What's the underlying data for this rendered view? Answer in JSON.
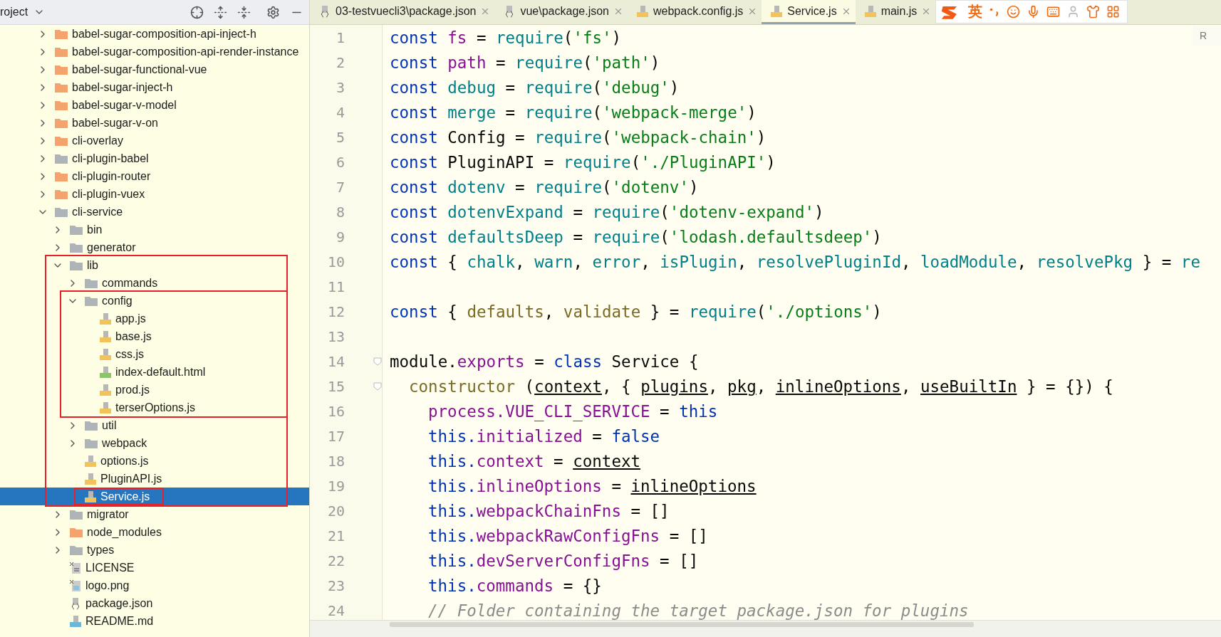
{
  "project_panel": {
    "title": "roject"
  },
  "tree": [
    {
      "name": "babel-sugar-composition-api-inject-h",
      "kind": "excluded-folder",
      "expanded": false,
      "selected": false,
      "outlined": false
    },
    {
      "name": "babel-sugar-composition-api-render-instance",
      "kind": "excluded-folder",
      "expanded": false,
      "selected": false,
      "outlined": false
    },
    {
      "name": "babel-sugar-functional-vue",
      "kind": "excluded-folder",
      "expanded": false,
      "selected": false,
      "outlined": false
    },
    {
      "name": "babel-sugar-inject-h",
      "kind": "excluded-folder",
      "expanded": false,
      "selected": false,
      "outlined": false
    },
    {
      "name": "babel-sugar-v-model",
      "kind": "excluded-folder",
      "expanded": false,
      "selected": false,
      "outlined": false
    },
    {
      "name": "babel-sugar-v-on",
      "kind": "excluded-folder",
      "expanded": false,
      "selected": false,
      "outlined": false
    },
    {
      "name": "cli-overlay",
      "kind": "excluded-folder",
      "expanded": false,
      "selected": false,
      "outlined": false
    },
    {
      "name": "cli-plugin-babel",
      "kind": "folder",
      "expanded": false,
      "selected": false,
      "outlined": false
    },
    {
      "name": "cli-plugin-router",
      "kind": "excluded-folder",
      "expanded": false,
      "selected": false,
      "outlined": false
    },
    {
      "name": "cli-plugin-vuex",
      "kind": "excluded-folder",
      "expanded": false,
      "selected": false,
      "outlined": false
    },
    {
      "name": "cli-service",
      "kind": "folder",
      "expanded": true,
      "selected": false,
      "outlined": false,
      "children": [
        {
          "name": "bin",
          "kind": "folder",
          "expanded": false,
          "selected": false,
          "outlined": false
        },
        {
          "name": "generator",
          "kind": "folder",
          "expanded": false,
          "selected": false,
          "outlined": false
        },
        {
          "name": "lib",
          "kind": "folder",
          "expanded": true,
          "selected": false,
          "outlined": true,
          "children": [
            {
              "name": "commands",
              "kind": "folder",
              "expanded": false,
              "selected": false,
              "outlined": false
            },
            {
              "name": "config",
              "kind": "folder",
              "expanded": true,
              "selected": false,
              "outlined": true,
              "children": [
                {
                  "name": "app.js",
                  "kind": "js",
                  "selected": false,
                  "outlined": false
                },
                {
                  "name": "base.js",
                  "kind": "js",
                  "selected": false,
                  "outlined": false
                },
                {
                  "name": "css.js",
                  "kind": "js",
                  "selected": false,
                  "outlined": false
                },
                {
                  "name": "index-default.html",
                  "kind": "html",
                  "selected": false,
                  "outlined": false
                },
                {
                  "name": "prod.js",
                  "kind": "js",
                  "selected": false,
                  "outlined": false
                },
                {
                  "name": "terserOptions.js",
                  "kind": "js",
                  "selected": false,
                  "outlined": false
                }
              ]
            },
            {
              "name": "util",
              "kind": "folder",
              "expanded": false,
              "selected": false,
              "outlined": false
            },
            {
              "name": "webpack",
              "kind": "folder",
              "expanded": false,
              "selected": false,
              "outlined": false
            },
            {
              "name": "options.js",
              "kind": "js",
              "selected": false,
              "outlined": false
            },
            {
              "name": "PluginAPI.js",
              "kind": "js",
              "selected": false,
              "outlined": false
            },
            {
              "name": "Service.js",
              "kind": "js",
              "selected": true,
              "outlined": true
            }
          ]
        },
        {
          "name": "migrator",
          "kind": "folder",
          "expanded": false,
          "selected": false,
          "outlined": false
        },
        {
          "name": "node_modules",
          "kind": "excluded-folder",
          "expanded": false,
          "selected": false,
          "outlined": false
        },
        {
          "name": "types",
          "kind": "folder",
          "expanded": false,
          "selected": false,
          "outlined": false
        },
        {
          "name": "LICENSE",
          "kind": "text",
          "selected": false,
          "outlined": false
        },
        {
          "name": "logo.png",
          "kind": "image",
          "selected": false,
          "outlined": false
        },
        {
          "name": "package.json",
          "kind": "json",
          "selected": false,
          "outlined": false
        },
        {
          "name": "README.md",
          "kind": "md",
          "selected": false,
          "outlined": false
        }
      ]
    }
  ],
  "tabs": [
    {
      "label": "03-testvuecli3\\package.json",
      "kind": "json",
      "selected": false
    },
    {
      "label": "vue\\package.json",
      "kind": "json",
      "selected": false
    },
    {
      "label": "webpack.config.js",
      "kind": "js",
      "selected": false
    },
    {
      "label": "Service.js",
      "kind": "js",
      "selected": true
    },
    {
      "label": "main.js",
      "kind": "js",
      "selected": false
    }
  ],
  "ime_toolbar": {
    "language": "英"
  },
  "editor_corner": "R",
  "code": [
    {
      "number": "1",
      "tokens": [
        {
          "kind": "kw",
          "text": "const "
        },
        {
          "kind": "def",
          "text": "fs"
        },
        {
          "kind": "plain",
          "text": " = "
        },
        {
          "kind": "fn",
          "text": "require"
        },
        {
          "kind": "plain",
          "text": "("
        },
        {
          "kind": "str",
          "text": "'fs'"
        },
        {
          "kind": "plain",
          "text": ")"
        }
      ]
    },
    {
      "number": "2",
      "tokens": [
        {
          "kind": "kw",
          "text": "const "
        },
        {
          "kind": "def",
          "text": "path"
        },
        {
          "kind": "plain",
          "text": " = "
        },
        {
          "kind": "fn",
          "text": "require"
        },
        {
          "kind": "plain",
          "text": "("
        },
        {
          "kind": "str",
          "text": "'path'"
        },
        {
          "kind": "plain",
          "text": ")"
        }
      ]
    },
    {
      "number": "3",
      "tokens": [
        {
          "kind": "kw",
          "text": "const "
        },
        {
          "kind": "fn",
          "text": "debug"
        },
        {
          "kind": "plain",
          "text": " = "
        },
        {
          "kind": "fn",
          "text": "require"
        },
        {
          "kind": "plain",
          "text": "("
        },
        {
          "kind": "str",
          "text": "'debug'"
        },
        {
          "kind": "plain",
          "text": ")"
        }
      ]
    },
    {
      "number": "4",
      "tokens": [
        {
          "kind": "kw",
          "text": "const "
        },
        {
          "kind": "fn",
          "text": "merge"
        },
        {
          "kind": "plain",
          "text": " = "
        },
        {
          "kind": "fn",
          "text": "require"
        },
        {
          "kind": "plain",
          "text": "("
        },
        {
          "kind": "str",
          "text": "'webpack-merge'"
        },
        {
          "kind": "plain",
          "text": ")"
        }
      ]
    },
    {
      "number": "5",
      "tokens": [
        {
          "kind": "kw",
          "text": "const "
        },
        {
          "kind": "plain",
          "text": "Config = "
        },
        {
          "kind": "fn",
          "text": "require"
        },
        {
          "kind": "plain",
          "text": "("
        },
        {
          "kind": "str",
          "text": "'webpack-chain'"
        },
        {
          "kind": "plain",
          "text": ")"
        }
      ]
    },
    {
      "number": "6",
      "tokens": [
        {
          "kind": "kw",
          "text": "const "
        },
        {
          "kind": "plain",
          "text": "PluginAPI = "
        },
        {
          "kind": "fn",
          "text": "require"
        },
        {
          "kind": "plain",
          "text": "("
        },
        {
          "kind": "str",
          "text": "'./PluginAPI'"
        },
        {
          "kind": "plain",
          "text": ")"
        }
      ]
    },
    {
      "number": "7",
      "tokens": [
        {
          "kind": "kw",
          "text": "const "
        },
        {
          "kind": "fn",
          "text": "dotenv"
        },
        {
          "kind": "plain",
          "text": " = "
        },
        {
          "kind": "fn",
          "text": "require"
        },
        {
          "kind": "plain",
          "text": "("
        },
        {
          "kind": "str",
          "text": "'dotenv'"
        },
        {
          "kind": "plain",
          "text": ")"
        }
      ]
    },
    {
      "number": "8",
      "tokens": [
        {
          "kind": "kw",
          "text": "const "
        },
        {
          "kind": "fn",
          "text": "dotenvExpand"
        },
        {
          "kind": "plain",
          "text": " = "
        },
        {
          "kind": "fn",
          "text": "require"
        },
        {
          "kind": "plain",
          "text": "("
        },
        {
          "kind": "str",
          "text": "'dotenv-expand'"
        },
        {
          "kind": "plain",
          "text": ")"
        }
      ]
    },
    {
      "number": "9",
      "tokens": [
        {
          "kind": "kw",
          "text": "const "
        },
        {
          "kind": "fn",
          "text": "defaultsDeep"
        },
        {
          "kind": "plain",
          "text": " = "
        },
        {
          "kind": "fn",
          "text": "require"
        },
        {
          "kind": "plain",
          "text": "("
        },
        {
          "kind": "str",
          "text": "'lodash.defaultsdeep'"
        },
        {
          "kind": "plain",
          "text": ")"
        }
      ]
    },
    {
      "number": "10",
      "tokens": [
        {
          "kind": "kw",
          "text": "const "
        },
        {
          "kind": "plain",
          "text": "{ "
        },
        {
          "kind": "fn",
          "text": "chalk"
        },
        {
          "kind": "plain",
          "text": ", "
        },
        {
          "kind": "fn",
          "text": "warn"
        },
        {
          "kind": "plain",
          "text": ", "
        },
        {
          "kind": "fn",
          "text": "error"
        },
        {
          "kind": "plain",
          "text": ", "
        },
        {
          "kind": "fn",
          "text": "isPlugin"
        },
        {
          "kind": "plain",
          "text": ", "
        },
        {
          "kind": "fn",
          "text": "resolvePluginId"
        },
        {
          "kind": "plain",
          "text": ", "
        },
        {
          "kind": "fn",
          "text": "loadModule"
        },
        {
          "kind": "plain",
          "text": ", "
        },
        {
          "kind": "fn",
          "text": "resolvePkg"
        },
        {
          "kind": "plain",
          "text": " } = "
        },
        {
          "kind": "fn",
          "text": "re"
        }
      ]
    },
    {
      "number": "11"
    },
    {
      "number": "12",
      "tokens": [
        {
          "kind": "kw",
          "text": "const "
        },
        {
          "kind": "plain",
          "text": "{ "
        },
        {
          "kind": "olive",
          "text": "defaults"
        },
        {
          "kind": "plain",
          "text": ", "
        },
        {
          "kind": "olive",
          "text": "validate"
        },
        {
          "kind": "plain",
          "text": " } = "
        },
        {
          "kind": "fn",
          "text": "require"
        },
        {
          "kind": "plain",
          "text": "("
        },
        {
          "kind": "str",
          "text": "'./options'"
        },
        {
          "kind": "plain",
          "text": ")"
        }
      ]
    },
    {
      "number": "13"
    },
    {
      "number": "14",
      "tokens": [
        {
          "kind": "plain",
          "text": "module."
        },
        {
          "kind": "prop",
          "text": "exports"
        },
        {
          "kind": "plain",
          "text": " = "
        },
        {
          "kind": "kw",
          "text": "class "
        },
        {
          "kind": "plain",
          "text": "Service {"
        }
      ],
      "children": [
        {
          "number": "15",
          "tokens": [
            {
              "kind": "olive",
              "text": "constructor"
            },
            {
              "kind": "plain",
              "text": " ("
            },
            {
              "kind": "param",
              "text": "context"
            },
            {
              "kind": "plain",
              "text": ", { "
            },
            {
              "kind": "param",
              "text": "plugins"
            },
            {
              "kind": "plain",
              "text": ", "
            },
            {
              "kind": "param",
              "text": "pkg"
            },
            {
              "kind": "plain",
              "text": ", "
            },
            {
              "kind": "param",
              "text": "inlineOptions"
            },
            {
              "kind": "plain",
              "text": ", "
            },
            {
              "kind": "param",
              "text": "useBuiltIn"
            },
            {
              "kind": "plain",
              "text": " } = {}) {"
            }
          ],
          "children": [
            {
              "number": "16",
              "tokens": [
                {
                  "kind": "prop",
                  "text": "process.VUE_CLI_SERVICE"
                },
                {
                  "kind": "plain",
                  "text": " = "
                },
                {
                  "kind": "kw",
                  "text": "this"
                }
              ]
            },
            {
              "number": "17",
              "tokens": [
                {
                  "kind": "kw",
                  "text": "this."
                },
                {
                  "kind": "prop",
                  "text": "initialized"
                },
                {
                  "kind": "plain",
                  "text": " = "
                },
                {
                  "kind": "kw",
                  "text": "false"
                }
              ]
            },
            {
              "number": "18",
              "tokens": [
                {
                  "kind": "kw",
                  "text": "this."
                },
                {
                  "kind": "prop",
                  "text": "context"
                },
                {
                  "kind": "plain",
                  "text": " = "
                },
                {
                  "kind": "param",
                  "text": "context"
                }
              ]
            },
            {
              "number": "19",
              "tokens": [
                {
                  "kind": "kw",
                  "text": "this."
                },
                {
                  "kind": "prop",
                  "text": "inlineOptions"
                },
                {
                  "kind": "plain",
                  "text": " = "
                },
                {
                  "kind": "param",
                  "text": "inlineOptions"
                }
              ]
            },
            {
              "number": "20",
              "tokens": [
                {
                  "kind": "kw",
                  "text": "this."
                },
                {
                  "kind": "prop",
                  "text": "webpackChainFns"
                },
                {
                  "kind": "plain",
                  "text": " = []"
                }
              ]
            },
            {
              "number": "21",
              "tokens": [
                {
                  "kind": "kw",
                  "text": "this."
                },
                {
                  "kind": "prop",
                  "text": "webpackRawConfigFns"
                },
                {
                  "kind": "plain",
                  "text": " = []"
                }
              ]
            },
            {
              "number": "22",
              "tokens": [
                {
                  "kind": "kw",
                  "text": "this."
                },
                {
                  "kind": "prop",
                  "text": "devServerConfigFns"
                },
                {
                  "kind": "plain",
                  "text": " = []"
                }
              ]
            },
            {
              "number": "23",
              "tokens": [
                {
                  "kind": "kw",
                  "text": "this."
                },
                {
                  "kind": "prop",
                  "text": "commands"
                },
                {
                  "kind": "plain",
                  "text": " = {}"
                }
              ]
            },
            {
              "number": "24",
              "tokens": [
                {
                  "kind": "comment",
                  "text": "// Folder containing the target package.json for plugins"
                }
              ]
            }
          ]
        }
      ]
    }
  ]
}
